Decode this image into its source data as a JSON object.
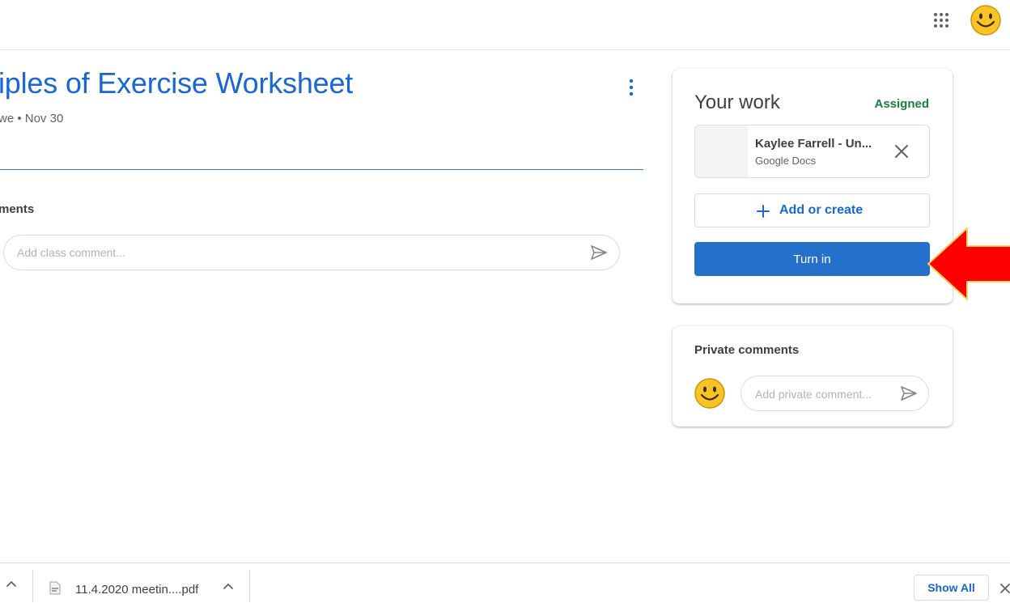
{
  "header": {
    "apps_icon": "apps-grid-icon",
    "avatar_icon": "smiley-avatar-icon"
  },
  "assignment": {
    "title": "iples of Exercise Worksheet",
    "meta": "we • Nov 30",
    "meta_stub": "",
    "menu_icon": "more-vert-icon",
    "class_comments_heading": "ments",
    "class_comment_placeholder": "Add class comment..."
  },
  "your_work": {
    "title": "Your work",
    "status": "Assigned",
    "attachment": {
      "name": "Kaylee Farrell - Un...",
      "type": "Google Docs"
    },
    "add_create_label": "Add or create",
    "turn_in_label": "Turn in"
  },
  "private_comments": {
    "title": "Private comments",
    "placeholder": "Add private comment..."
  },
  "download_bar": {
    "file_name": "11.4.2020 meetin....pdf",
    "show_all_label": "Show All"
  },
  "colors": {
    "title_blue": "#1967d2",
    "assigned_green": "#188038",
    "turn_in_blue": "#2470cb",
    "annotation_red": "#ff0000"
  }
}
